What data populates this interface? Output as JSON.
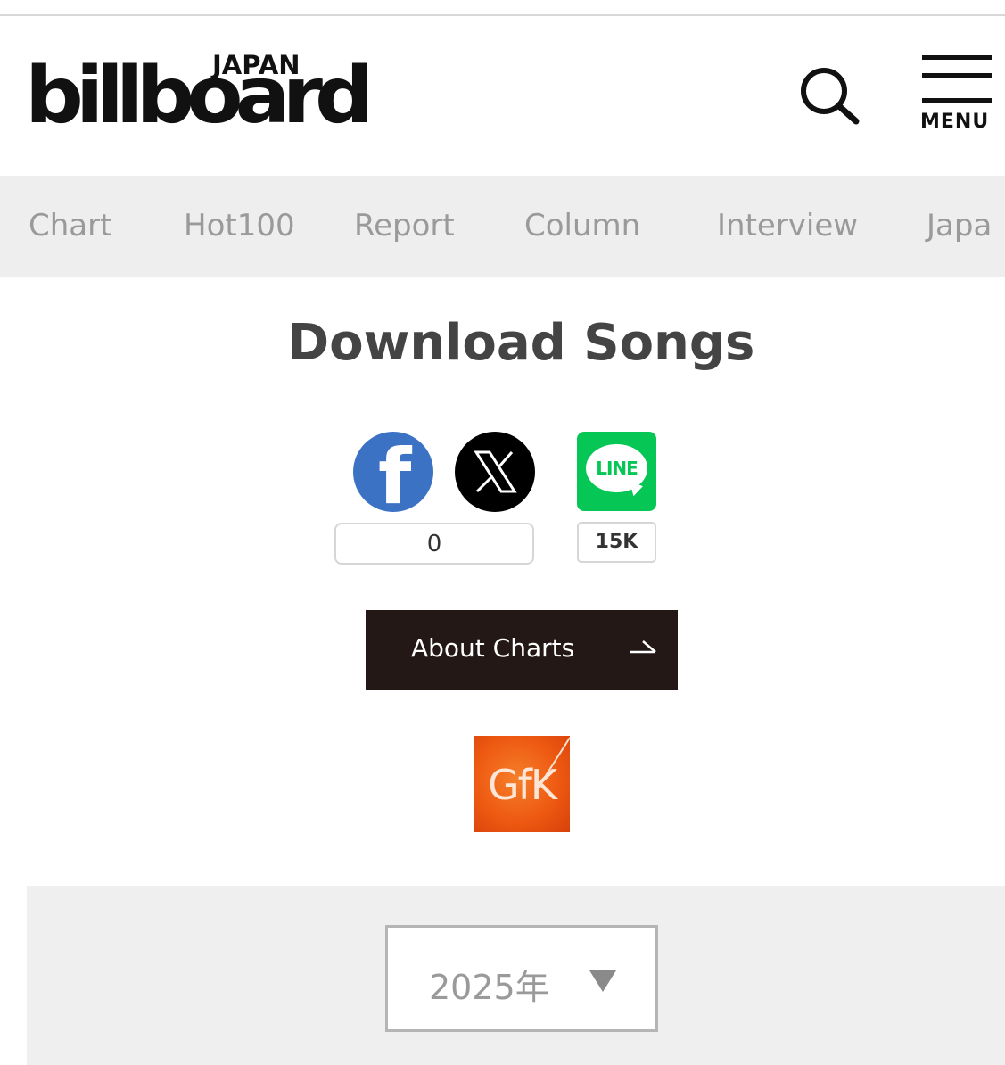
{
  "header": {
    "logo_sub": "JAPAN",
    "logo_main": "billboard",
    "search_icon": "search-icon",
    "menu_icon": "hamburger-icon",
    "menu_label": "MENU"
  },
  "nav": {
    "items": [
      {
        "label": "Chart"
      },
      {
        "label": "Hot100"
      },
      {
        "label": "Report"
      },
      {
        "label": "Column"
      },
      {
        "label": "Interview"
      },
      {
        "label": "Japa"
      }
    ]
  },
  "page": {
    "title": "Download Songs"
  },
  "share": {
    "facebook_icon": "facebook-icon",
    "facebook_count": "0",
    "x_icon": "x-icon",
    "line_icon": "line-icon",
    "line_text": "LINE",
    "line_count": "15K"
  },
  "about_button": {
    "label": "About Charts",
    "icon": "arrow-right-icon"
  },
  "sponsor": {
    "logo_text": "GfK"
  },
  "year_select": {
    "selected": "2025年",
    "icon": "caret-down-icon"
  },
  "colors": {
    "facebook": "#3b72c4",
    "line": "#06c755",
    "about_bg": "#231815",
    "nav_bg": "#eeeeee",
    "gfk": "#ee5a12"
  }
}
